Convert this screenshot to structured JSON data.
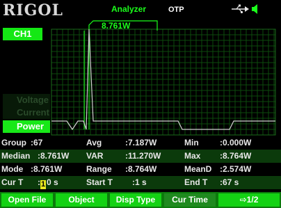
{
  "brand": "RIGOL",
  "mode": "Analyzer",
  "submode": "OTP",
  "icons": {
    "usb": "usb-icon",
    "speaker": "speaker-icon"
  },
  "channel": "CH1",
  "trigger_value": "8.761W",
  "side_labels": [
    "Voltage",
    "Current",
    "Power"
  ],
  "stats": {
    "row1": {
      "l1": "Group",
      "v1": ":67",
      "l2": "Avg",
      "v2": ":7.187W",
      "l3": "Min",
      "v3": ":0.000W"
    },
    "row2": {
      "l1": "Median",
      "v1": ":8.761W",
      "l2": "VAR",
      "v2": ":11.270W",
      "l3": "Max",
      "v3": ":8.764W"
    },
    "row3": {
      "l1": "Mode",
      "v1": ":8.761W",
      "l2": "Range",
      "v2": ":8.764W",
      "l3": "MeanD",
      "v3": ":2.574W"
    },
    "row4": {
      "l1": "Cur T",
      "v1": ":",
      "cursor_digit": "1",
      "v1b": "0 s",
      "l2": "Start T",
      "v2": ":1 s",
      "l3": "End T",
      "v3": ":67 s"
    }
  },
  "menu": [
    "Open File",
    "Object",
    "Disp Type",
    "Cur Time",
    "⇨1/2"
  ],
  "colors": {
    "accent": "#14e814",
    "background": "#000000",
    "row_alt": "#0b3a0b",
    "trace": "#d0d0d0"
  }
}
